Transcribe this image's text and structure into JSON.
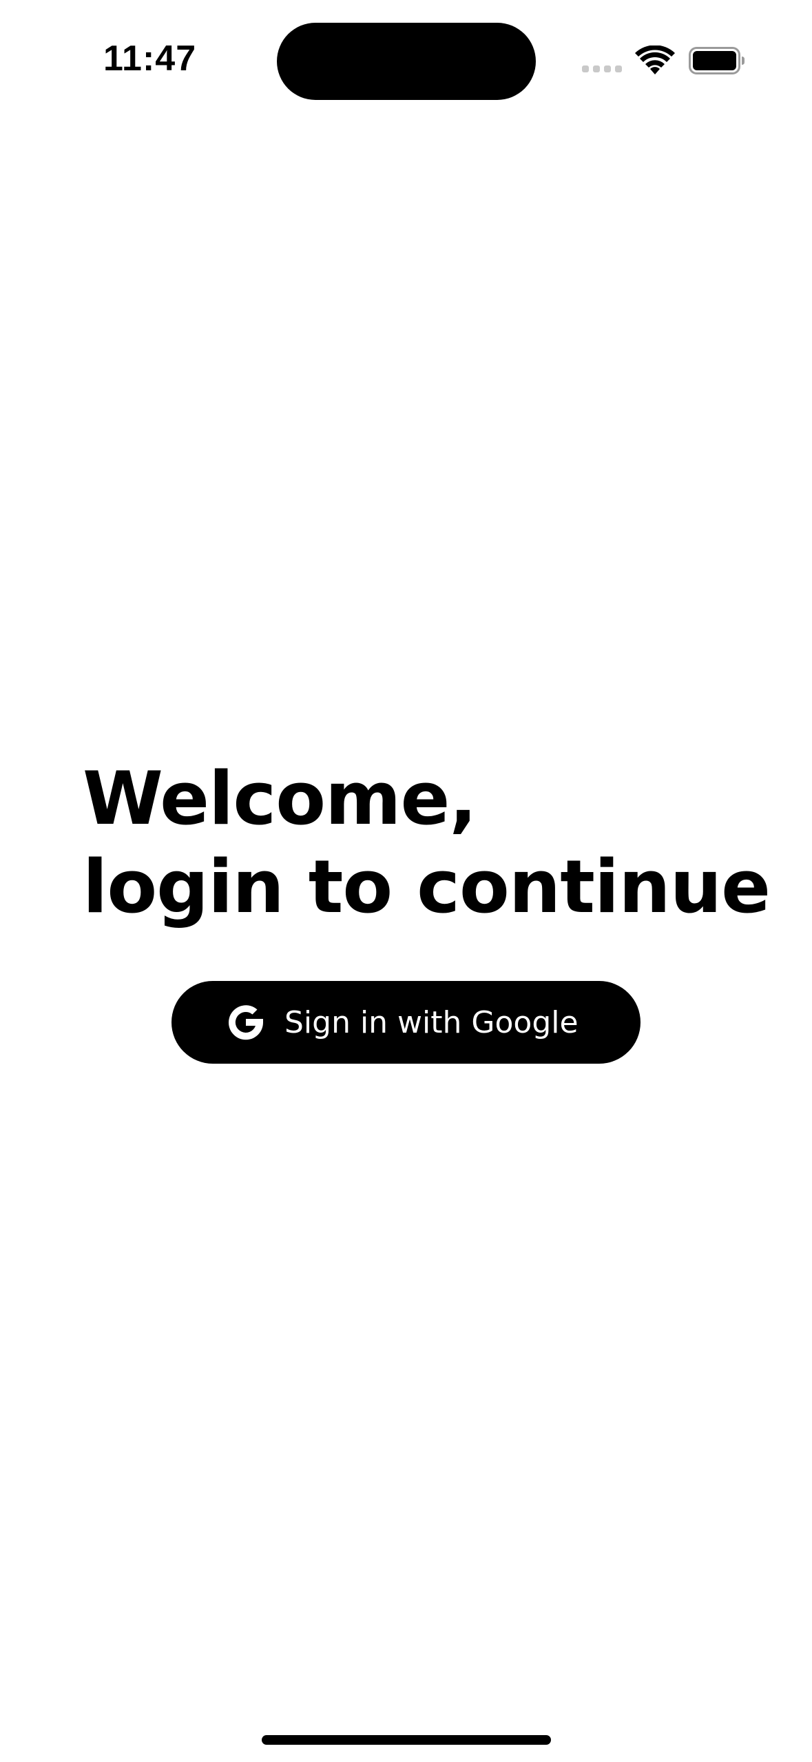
{
  "status_bar": {
    "time": "11:47"
  },
  "heading": {
    "line1": "Welcome,",
    "line2": "login to continue"
  },
  "google_button": {
    "label": "Sign in with Google",
    "icon": "google-icon"
  },
  "colors": {
    "background": "#ffffff",
    "text": "#000000",
    "button_bg": "#000000",
    "button_text": "#ffffff",
    "signal_inactive": "#c9c9c9"
  }
}
